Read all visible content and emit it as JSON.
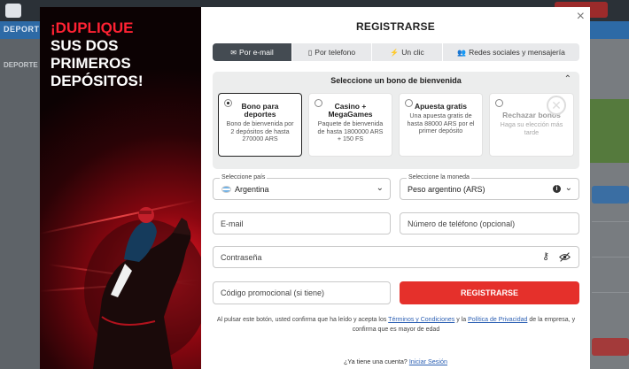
{
  "promo": {
    "title_red": "¡DUPLIQUE",
    "title_line2": "SUS DOS PRIMEROS",
    "title_line3": "DEPÓSITOS!"
  },
  "background": {
    "nav_text": "DEPORTES",
    "left_text": "DEPORTE"
  },
  "modal": {
    "title": "REGISTRARSE",
    "close": "×",
    "tabs": [
      {
        "label": "Por e-mail",
        "icon": "envelope-icon",
        "active": true
      },
      {
        "label": "Por telefono",
        "icon": "phone-icon",
        "active": false
      },
      {
        "label": "Un clic",
        "icon": "lightning-icon",
        "active": false
      },
      {
        "label": "Redes sociales y mensajería",
        "icon": "people-icon",
        "active": false
      }
    ],
    "bonus": {
      "header": "Seleccione un bono de bienvenida",
      "cards": [
        {
          "title": "Bono para deportes",
          "desc": "Bono de bienvenida por 2 depósitos de hasta 270000 ARS",
          "selected": true
        },
        {
          "title": "Casino + MegaGames",
          "desc": "Paquete de bienvenida de hasta 1800000 ARS + 150 FS",
          "selected": false
        },
        {
          "title": "Apuesta gratis",
          "desc": "Una apuesta gratis de hasta 88000 ARS por el primer depósito",
          "selected": false
        },
        {
          "title": "Rechazar bonos",
          "desc": "Haga su elección más tarde",
          "selected": false
        }
      ]
    },
    "country": {
      "label": "Seleccione país",
      "value": "Argentina"
    },
    "currency": {
      "label": "Seleccione la moneda",
      "value": "Peso argentino (ARS)"
    },
    "email_placeholder": "E-mail",
    "phone_placeholder": "Número de teléfono (opcional)",
    "password_placeholder": "Contraseña",
    "promo_placeholder": "Código promocional (si tiene)",
    "submit": "REGISTRARSE",
    "terms": {
      "part1": "Al pulsar este botón, usted confirma que ha leído y acepta los ",
      "link1": "Términos y Condiciones",
      "part2": " y la ",
      "link2": "Política de Privacidad",
      "part3": " de la empresa, y confirma que es mayor de edad"
    },
    "login": {
      "text": "¿Ya tiene una cuenta? ",
      "link": "Iniciar Sesión"
    }
  }
}
